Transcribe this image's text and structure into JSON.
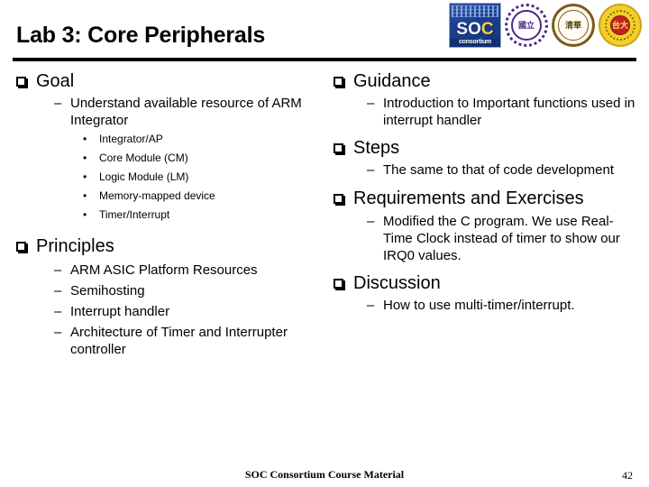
{
  "slide": {
    "title": "Lab 3: Core Peripherals",
    "footer": "SOC Consortium Course Material",
    "page_number": "42"
  },
  "logos": [
    {
      "name": "soc-consortium-logo",
      "word": "SO",
      "word_accent": "C",
      "subtitle": "consortium"
    },
    {
      "name": "nctu-seal-logo",
      "glyph": "國立"
    },
    {
      "name": "nthu-seal-logo",
      "glyph": "清華"
    },
    {
      "name": "ntu-seal-logo",
      "glyph": "台大"
    }
  ],
  "left_column": {
    "goal": {
      "heading": "Goal",
      "items": [
        {
          "text": "Understand available resource of ARM Integrator",
          "subitems": [
            "Integrator/AP",
            "Core Module (CM)",
            "Logic Module (LM)",
            "Memory-mapped device",
            "Timer/Interrupt"
          ]
        }
      ]
    },
    "principles": {
      "heading": "Principles",
      "items": [
        "ARM ASIC Platform Resources",
        "Semihosting",
        "Interrupt handler",
        "Architecture of Timer and Interrupter controller"
      ]
    }
  },
  "right_column": {
    "guidance": {
      "heading": "Guidance",
      "items": [
        "Introduction to Important functions used in interrupt handler"
      ]
    },
    "steps": {
      "heading": "Steps",
      "items": [
        "The same to that of code development"
      ]
    },
    "requirements": {
      "heading": "Requirements and Exercises",
      "items": [
        "Modified the C program. We use Real-Time Clock instead of timer to show our IRQ0 values."
      ]
    },
    "discussion": {
      "heading": "Discussion",
      "items": [
        "How to use multi-timer/interrupt."
      ]
    }
  },
  "icons": {
    "bullet_square": "❑",
    "bullet_dash": "–",
    "bullet_dot": "•"
  },
  "colors": {
    "text": "#000000",
    "background": "#ffffff",
    "rule": "#000000",
    "soc_blue": "#1d3f8f",
    "nctu_purple": "#4b2a86",
    "nthu_brown": "#7a5a1e",
    "ntu_yellow": "#f4cf2a",
    "ntu_red": "#c0241c"
  }
}
